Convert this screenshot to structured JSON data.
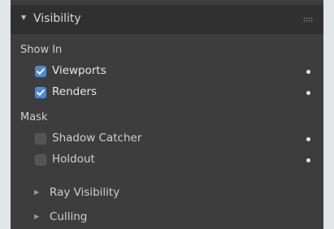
{
  "panel": {
    "title": "Visibility",
    "show_in": {
      "label": "Show In",
      "items": [
        {
          "label": "Viewports",
          "checked": true
        },
        {
          "label": "Renders",
          "checked": true
        }
      ]
    },
    "mask": {
      "label": "Mask",
      "items": [
        {
          "label": "Shadow Catcher",
          "checked": false
        },
        {
          "label": "Holdout",
          "checked": false
        }
      ]
    },
    "subpanels": [
      {
        "label": "Ray Visibility",
        "expanded": false
      },
      {
        "label": "Culling",
        "expanded": false
      }
    ]
  },
  "colors": {
    "accent": "#4c8ad1",
    "panel_bg": "#3d3d3d",
    "header_bg": "#303030"
  }
}
